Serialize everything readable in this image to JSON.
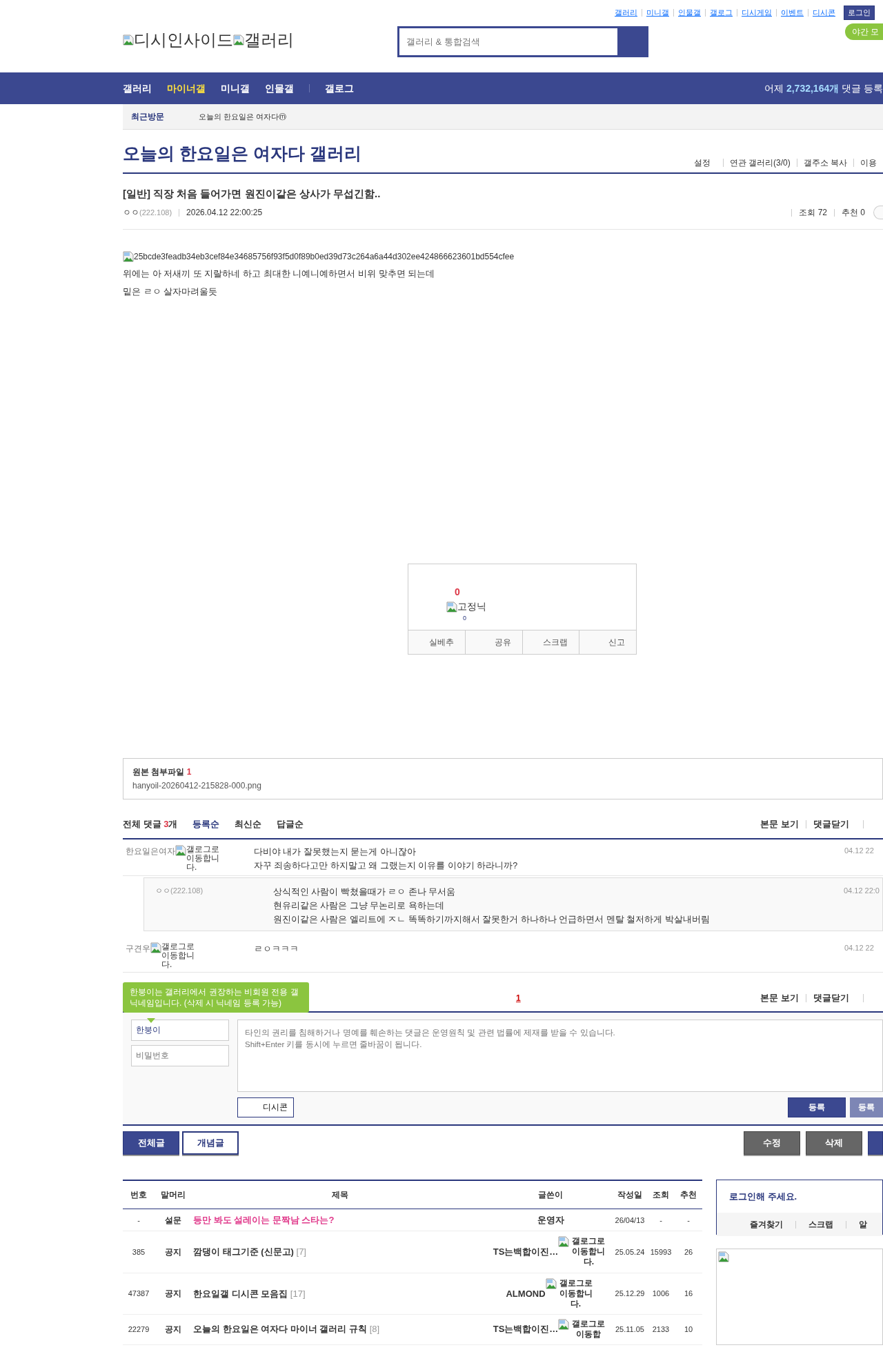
{
  "top_links": [
    {
      "label": "갤러리"
    },
    {
      "label": "미니갤"
    },
    {
      "label": "인물갤"
    },
    {
      "label": "갤로그"
    },
    {
      "label": "디시게임"
    },
    {
      "label": "이벤트"
    },
    {
      "label": "디시콘"
    }
  ],
  "login_button": "로그인",
  "logo": {
    "site": "디시인사이드",
    "section": "갤러리"
  },
  "search": {
    "placeholder": "갤러리 & 통합검색"
  },
  "night_mode_button": "야간 모",
  "nav": {
    "items": [
      {
        "label": "갤러리",
        "selected": false
      },
      {
        "label": "마이너갤",
        "selected": true
      },
      {
        "label": "미니갤",
        "selected": false
      },
      {
        "label": "인물갤",
        "selected": false
      },
      {
        "label": "갤로그",
        "selected": false
      }
    ],
    "stat_prefix": "어제",
    "stat_count": "2,732,164개",
    "stat_suffix": "댓글 등록"
  },
  "recent": {
    "label": "최근방문",
    "items": [
      "오늘의 한요일은 여자다ⓜ"
    ]
  },
  "gallery": {
    "title": "오늘의 한요일은 여자다 갤러리",
    "links": [
      "설정",
      "연관 갤러리(3/0)",
      "갤주소 복사",
      "이용"
    ]
  },
  "post": {
    "title": "[일반] 직장 처음 들어가면 원진이같은 상사가 무섭긴함..",
    "author": "ㅇㅇ",
    "ip": "(222.108)",
    "date": "2026.04.12 22:00:25",
    "views": "조회 72",
    "recommend": "추천 0",
    "image_alt": "25bcde3feadb34eb3cef84e34685756f93f5d0f89b0ed39d73c264a6a44d302ee424866623601bd554cfee",
    "lines": [
      "위에는 아 저새끼 또 지랄하네 하고 최대한 니예니예하면서 비위 맞추면 되는데",
      "밑은 ㄹㅇ 살자마려울듯"
    ]
  },
  "vote": {
    "up_count": "0",
    "nick_label": "고정닉",
    "nick_count": "0",
    "actions": [
      "실베추",
      "공유",
      "스크랩",
      "신고"
    ]
  },
  "attachment": {
    "label": "원본 첨부파일",
    "count": "1",
    "file": "hanyoil-20260412-215828-000.png"
  },
  "comments": {
    "label": "전체 댓글",
    "count": "3",
    "unit": "개",
    "sorts": [
      {
        "label": "등록순",
        "selected": true
      },
      {
        "label": "최신순",
        "selected": false
      },
      {
        "label": "답글순",
        "selected": false
      }
    ],
    "links": [
      "본문 보기",
      "댓글닫기"
    ],
    "items": [
      {
        "kind": "comment",
        "author": "한요일은여자",
        "badge_alt": "갤로그로 이동합니다.",
        "lines": [
          "다비야 내가 잘못했는지 묻는게 아니잖아",
          "자꾸 죄송하다고만 하지말고 왜 그랬는지 이유를 이야기 하라니까?"
        ],
        "date": "04.12 22"
      },
      {
        "kind": "reply",
        "author": "ㅇㅇ",
        "ip": "(222.108)",
        "lines": [
          "상식적인 사람이 빡쳤을때가 ㄹㅇ 존나 무서움",
          "현유리같은 사람은 그냥 무논리로 욕하는데",
          "원진이같은 사람은 엘리트에 ㅈㄴ 똑똑하기까지해서 잘못한거 하나하나 언급하면서 멘탈 철저하게 박살내버림"
        ],
        "date": "04.12 22:0"
      },
      {
        "kind": "comment",
        "author": "구견우",
        "badge_alt": "갤로그로 이동합니다.",
        "lines": [
          "ㄹㅇㅋㅋㅋ"
        ],
        "date": "04.12 22"
      }
    ]
  },
  "pagination": {
    "pages": [
      {
        "label": "1",
        "selected": true
      }
    ],
    "links": [
      "본문 보기",
      "댓글닫기"
    ]
  },
  "comment_form": {
    "tooltip": "한붕이는 갤러리에서 권장하는 비회원 전용 갤닉네임입니다. (삭제 시 닉네임 등록 가능)",
    "name_value": "한붕이",
    "password_placeholder": "비밀번호",
    "text_placeholder": "타인의 권리를 침해하거나 명예를 훼손하는 댓글은 운영원칙 및 관련 법률에 제재를 받을 수 있습니다.\nShift+Enter 키를 동시에 누르면 줄바꿈이 됩니다.",
    "dccon_button": "디시콘",
    "submit_buttons": [
      {
        "label": "등록",
        "disabled": false
      },
      {
        "label": "등록",
        "disabled": true
      }
    ]
  },
  "actions": {
    "left": [
      {
        "label": "전체글",
        "kind": "primary"
      },
      {
        "label": "개념글",
        "kind": "outline"
      }
    ],
    "right": [
      {
        "label": "수정",
        "kind": "secondary"
      },
      {
        "label": "삭제",
        "kind": "secondary"
      },
      {
        "kind": "primary"
      }
    ]
  },
  "table": {
    "columns": [
      "번호",
      "말머리",
      "제목",
      "글쓴이",
      "작성일",
      "조회",
      "추천"
    ],
    "rows": [
      {
        "kind": "survey",
        "number": "-",
        "head": "설문",
        "title": "등만 봐도 설레이는 문짝남 스타는?",
        "writer": "운영자",
        "date": "26/04/13",
        "views": "-",
        "likes": "-"
      },
      {
        "kind": "notice",
        "number": "385",
        "head": "공지",
        "title": "깜댕이 태그기준 (신문고)",
        "reply_count": "[7]",
        "writer": "TS는백합이진…",
        "writer_badge_alt": "갤로그로 이동합니다.",
        "date": "25.05.24",
        "views": "15993",
        "likes": "26"
      },
      {
        "kind": "notice",
        "number": "47387",
        "head": "공지",
        "title": "한요일갤 디시콘 모음집",
        "reply_count": "[17]",
        "writer": "ALMOND",
        "writer_badge_alt": "갤로그로 이동합니다.",
        "date": "25.12.29",
        "views": "1006",
        "likes": "16"
      },
      {
        "kind": "notice",
        "number": "22279",
        "head": "공지",
        "title": "오늘의 한요일은 여자다 마이너 갤러리 규칙",
        "reply_count": "[8]",
        "writer": "TS는백합이진…",
        "writer_badge_alt": "갤로그로 이동합",
        "date": "25.11.05",
        "views": "2133",
        "likes": "10"
      }
    ]
  },
  "sidebar": {
    "login_prompt": "로그인해 주세요.",
    "links": [
      "즐겨찾기",
      "스크랩",
      "알"
    ]
  }
}
